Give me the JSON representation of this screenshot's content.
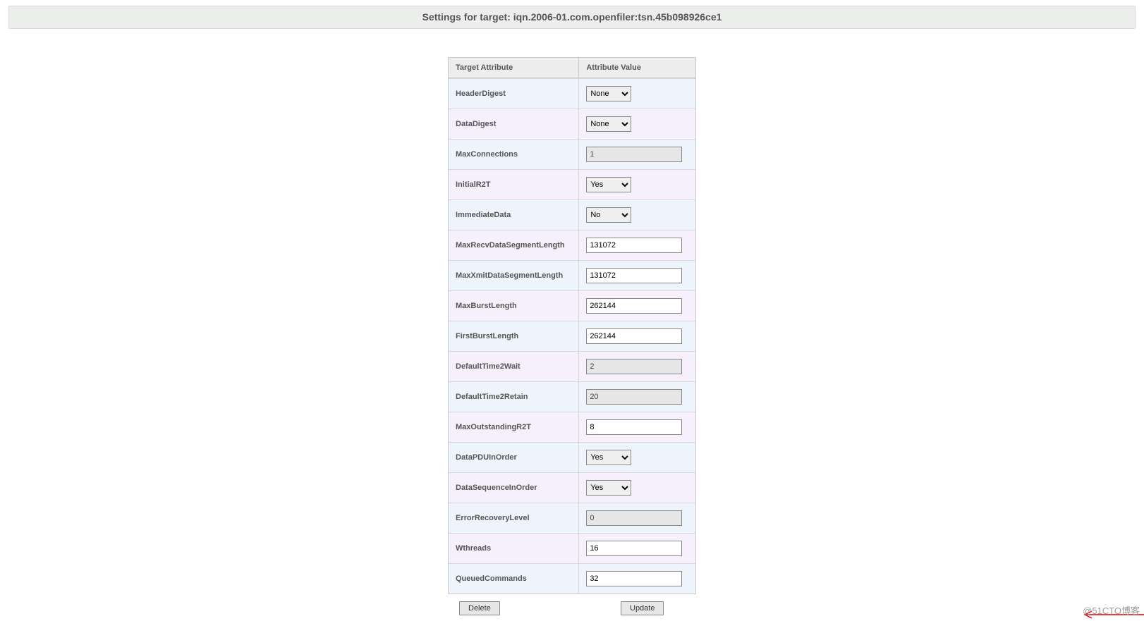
{
  "title": "Settings for target: iqn.2006-01.com.openfiler:tsn.45b098926ce1",
  "columns": {
    "attr": "Target Attribute",
    "value": "Attribute Value"
  },
  "rows": [
    {
      "name": "HeaderDigest",
      "type": "select",
      "value": "None",
      "disabled": false
    },
    {
      "name": "DataDigest",
      "type": "select",
      "value": "None",
      "disabled": false
    },
    {
      "name": "MaxConnections",
      "type": "text",
      "value": "1",
      "disabled": true
    },
    {
      "name": "InitialR2T",
      "type": "select",
      "value": "Yes",
      "disabled": false
    },
    {
      "name": "ImmediateData",
      "type": "select",
      "value": "No",
      "disabled": false
    },
    {
      "name": "MaxRecvDataSegmentLength",
      "type": "text",
      "value": "131072",
      "disabled": false
    },
    {
      "name": "MaxXmitDataSegmentLength",
      "type": "text",
      "value": "131072",
      "disabled": false
    },
    {
      "name": "MaxBurstLength",
      "type": "text",
      "value": "262144",
      "disabled": false
    },
    {
      "name": "FirstBurstLength",
      "type": "text",
      "value": "262144",
      "disabled": false
    },
    {
      "name": "DefaultTime2Wait",
      "type": "text",
      "value": "2",
      "disabled": true
    },
    {
      "name": "DefaultTime2Retain",
      "type": "text",
      "value": "20",
      "disabled": true
    },
    {
      "name": "MaxOutstandingR2T",
      "type": "text",
      "value": "8",
      "disabled": false
    },
    {
      "name": "DataPDUInOrder",
      "type": "select",
      "value": "Yes",
      "disabled": false
    },
    {
      "name": "DataSequenceInOrder",
      "type": "select",
      "value": "Yes",
      "disabled": false
    },
    {
      "name": "ErrorRecoveryLevel",
      "type": "text",
      "value": "0",
      "disabled": true
    },
    {
      "name": "Wthreads",
      "type": "text",
      "value": "16",
      "disabled": false
    },
    {
      "name": "QueuedCommands",
      "type": "text",
      "value": "32",
      "disabled": false
    }
  ],
  "buttons": {
    "delete": "Delete",
    "update": "Update"
  },
  "watermark": "@51CTO博客"
}
